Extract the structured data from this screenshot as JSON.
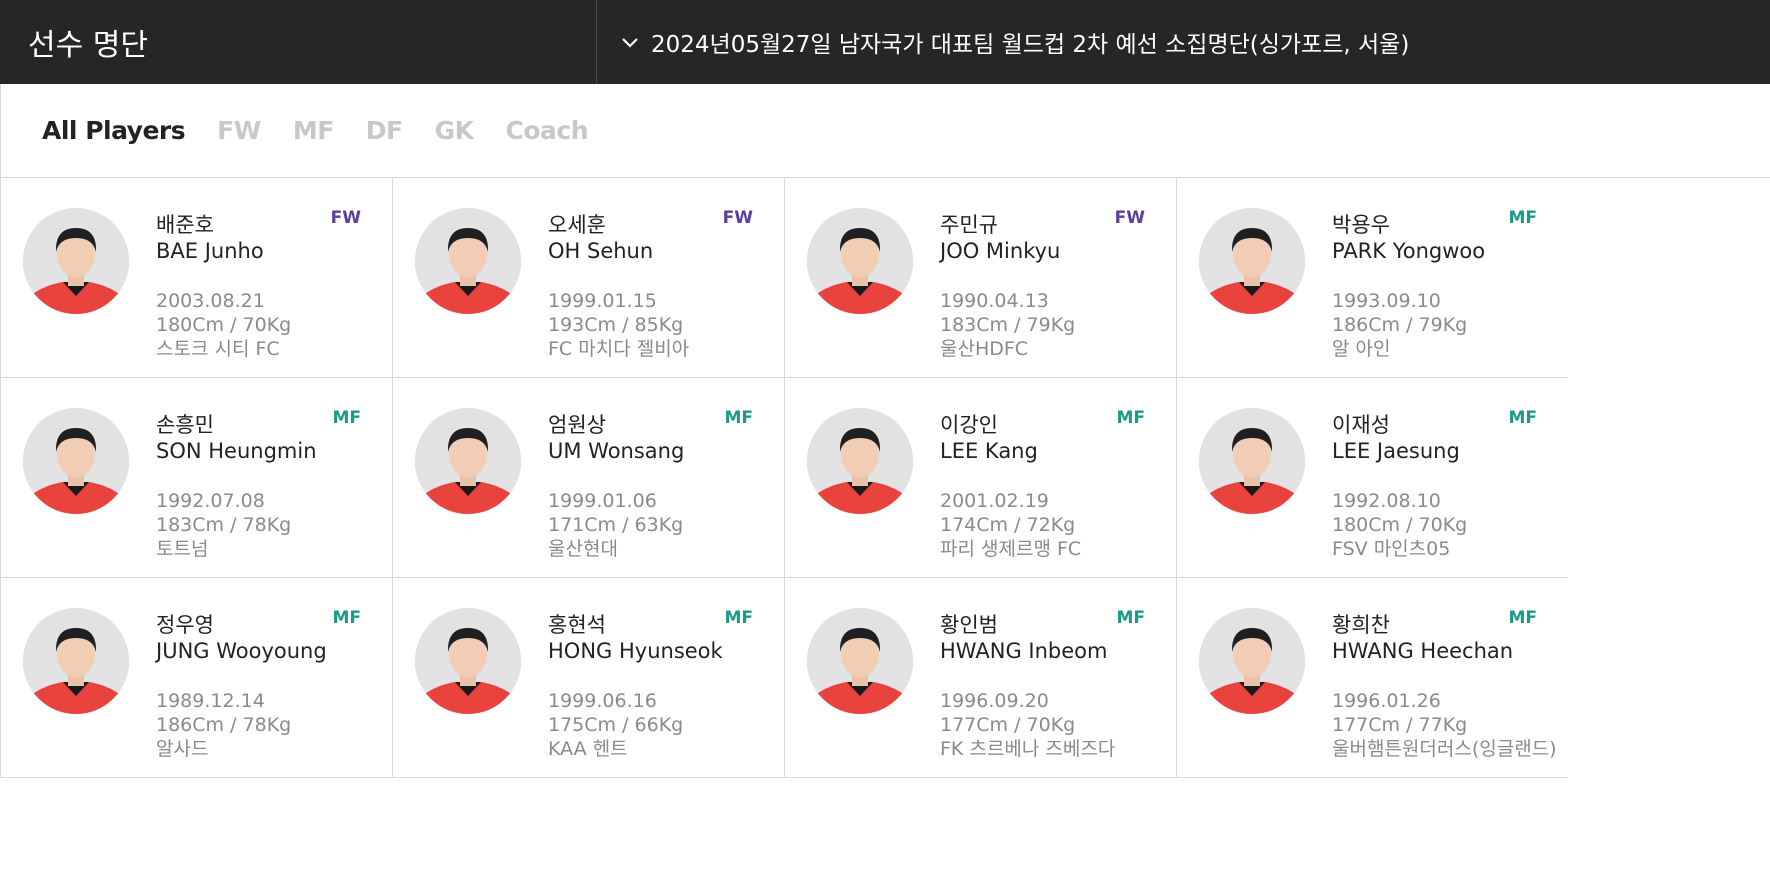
{
  "header": {
    "title": "선수 명단",
    "selected_roster": "2024년05월27일 남자국가 대표팀 월드컵 2차 예선 소집명단(싱가포르, 서울)"
  },
  "filters": {
    "tabs": [
      "All Players",
      "FW",
      "MF",
      "DF",
      "GK",
      "Coach"
    ],
    "active": "All Players"
  },
  "colors": {
    "header_bg": "#262626",
    "fw": "#5b3fa0",
    "mf": "#1a9b86",
    "jersey": "#e8423d"
  },
  "players": [
    {
      "name_kr": "배준호",
      "name_en": "BAE Junho",
      "position": "FW",
      "birth": "2003.08.21",
      "body": "180Cm / 70Kg",
      "club": "스토크 시티 FC"
    },
    {
      "name_kr": "오세훈",
      "name_en": "OH Sehun",
      "position": "FW",
      "birth": "1999.01.15",
      "body": "193Cm / 85Kg",
      "club": "FC 마치다 젤비아"
    },
    {
      "name_kr": "주민규",
      "name_en": "JOO Minkyu",
      "position": "FW",
      "birth": "1990.04.13",
      "body": "183Cm / 79Kg",
      "club": "울산HDFC"
    },
    {
      "name_kr": "박용우",
      "name_en": "PARK Yongwoo",
      "position": "MF",
      "birth": "1993.09.10",
      "body": "186Cm / 79Kg",
      "club": "알 아인"
    },
    {
      "name_kr": "손흥민",
      "name_en": "SON Heungmin",
      "position": "MF",
      "birth": "1992.07.08",
      "body": "183Cm / 78Kg",
      "club": "토트넘"
    },
    {
      "name_kr": "엄원상",
      "name_en": "UM Wonsang",
      "position": "MF",
      "birth": "1999.01.06",
      "body": "171Cm / 63Kg",
      "club": "울산현대"
    },
    {
      "name_kr": "이강인",
      "name_en": "LEE Kang",
      "position": "MF",
      "birth": "2001.02.19",
      "body": "174Cm / 72Kg",
      "club": "파리 생제르맹 FC"
    },
    {
      "name_kr": "이재성",
      "name_en": "LEE Jaesung",
      "position": "MF",
      "birth": "1992.08.10",
      "body": "180Cm / 70Kg",
      "club": "FSV 마인츠05"
    },
    {
      "name_kr": "정우영",
      "name_en": "JUNG Wooyoung",
      "position": "MF",
      "birth": "1989.12.14",
      "body": "186Cm / 78Kg",
      "club": "알사드"
    },
    {
      "name_kr": "홍현석",
      "name_en": "HONG Hyunseok",
      "position": "MF",
      "birth": "1999.06.16",
      "body": "175Cm / 66Kg",
      "club": "KAA 헨트"
    },
    {
      "name_kr": "황인범",
      "name_en": "HWANG Inbeom",
      "position": "MF",
      "birth": "1996.09.20",
      "body": "177Cm / 70Kg",
      "club": "FK 츠르베나 즈베즈다"
    },
    {
      "name_kr": "황희찬",
      "name_en": "HWANG Heechan",
      "position": "MF",
      "birth": "1996.01.26",
      "body": "177Cm / 77Kg",
      "club": "울버햄튼원더러스(잉글랜드)"
    }
  ]
}
